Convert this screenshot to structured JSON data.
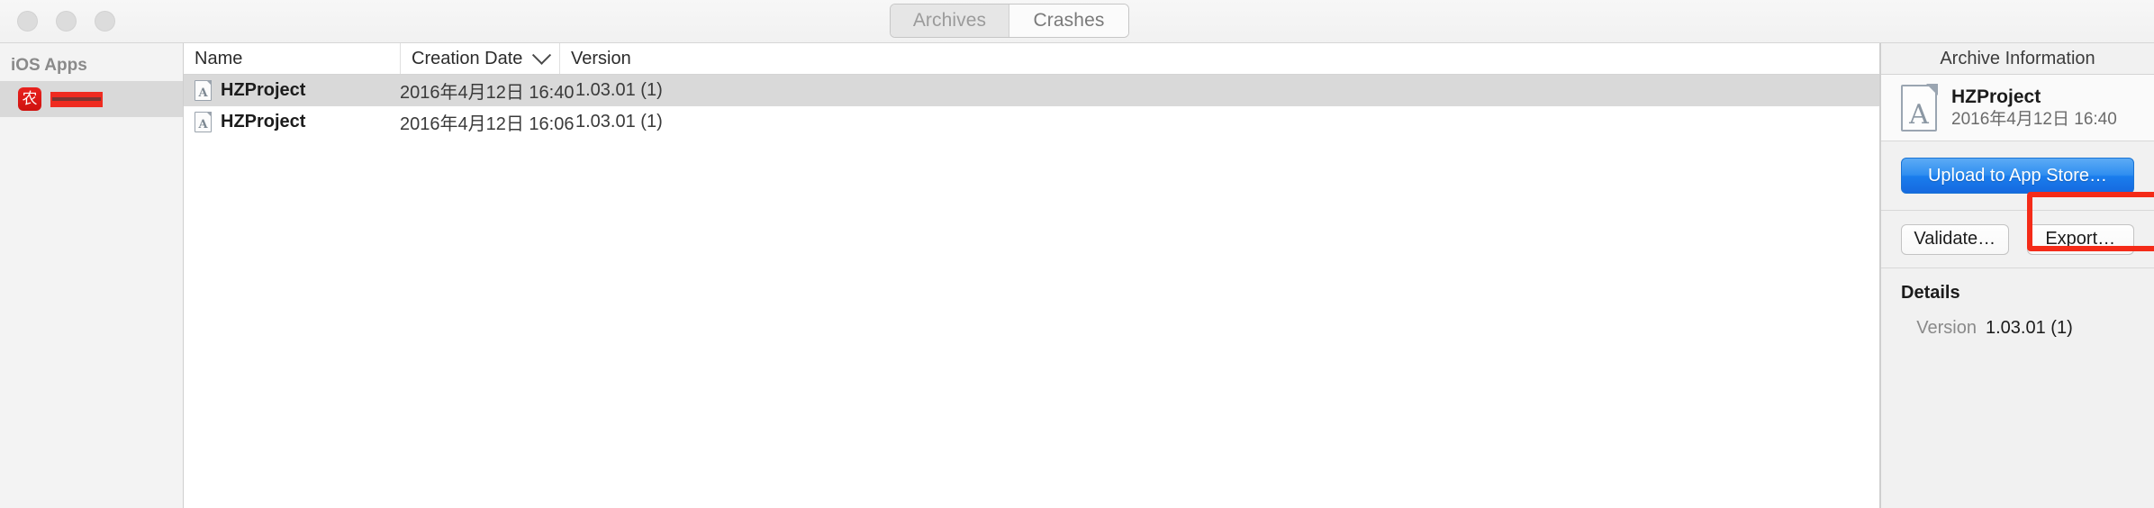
{
  "titlebar": {
    "traffic_lights": [
      "close",
      "minimize",
      "zoom"
    ],
    "segmented_control": {
      "selected": "Archives",
      "options": [
        {
          "label": "Archives",
          "selected": true
        },
        {
          "label": "Crashes",
          "selected": false
        }
      ]
    }
  },
  "sidebar": {
    "group_label": "iOS Apps",
    "items": [
      {
        "label": "",
        "icon": "app-icon-red",
        "icon_glyph": "农",
        "redacted": true,
        "selected": true
      }
    ]
  },
  "table": {
    "columns": [
      {
        "key": "name",
        "label": "Name"
      },
      {
        "key": "date",
        "label": "Creation Date",
        "sort_icon": "chevron-down-icon"
      },
      {
        "key": "version",
        "label": "Version"
      }
    ],
    "rows": [
      {
        "name": "HZProject",
        "date": "2016年4月12日 16:40",
        "version": "1.03.01 (1)",
        "selected": true,
        "icon": "archive-document-icon"
      },
      {
        "name": "HZProject",
        "date": "2016年4月12日 16:06",
        "version": "1.03.01 (1)",
        "selected": false,
        "icon": "archive-document-icon"
      }
    ]
  },
  "inspector": {
    "title": "Archive Information",
    "summary": {
      "icon": "archive-document-icon",
      "name": "HZProject",
      "date": "2016年4月12日 16:40"
    },
    "upload_button": "Upload to App Store…",
    "validate_button": "Validate…",
    "export_button": "Export…",
    "export_highlight_color": "#f42b18",
    "details": {
      "title": "Details",
      "rows": [
        {
          "label": "Version",
          "value": "1.03.01 (1)"
        }
      ]
    }
  }
}
